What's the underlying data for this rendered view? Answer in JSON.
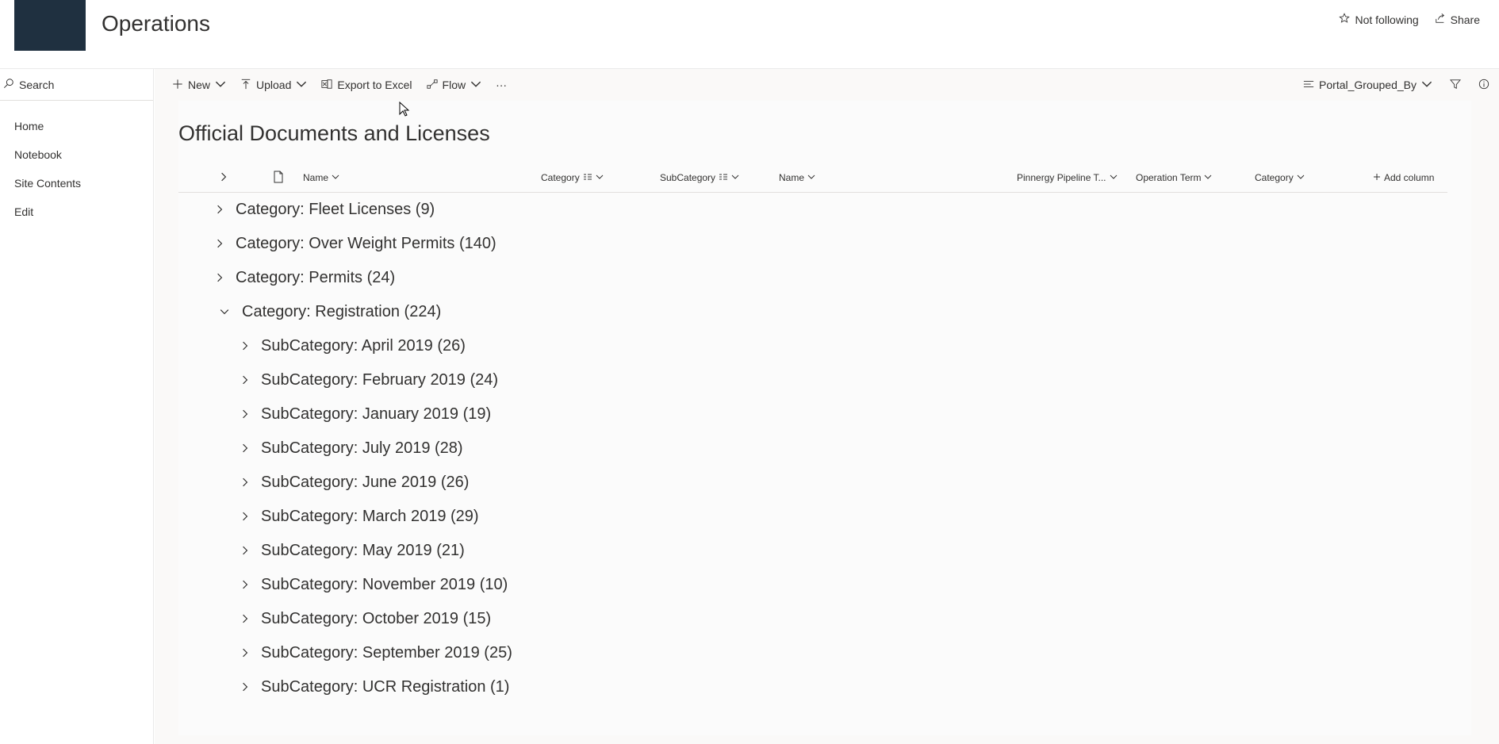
{
  "header": {
    "site_title": "Operations",
    "follow_label": "Not following",
    "share_label": "Share",
    "logo_color": "#1f3040"
  },
  "leftnav": {
    "search_placeholder": "Search",
    "items": [
      {
        "label": "Home"
      },
      {
        "label": "Notebook"
      },
      {
        "label": "Site Contents"
      },
      {
        "label": "Edit"
      }
    ]
  },
  "commandbar": {
    "new_label": "New",
    "upload_label": "Upload",
    "export_label": "Export to Excel",
    "flow_label": "Flow",
    "more_label": "···",
    "view_label": "Portal_Grouped_By"
  },
  "list": {
    "title": "Official Documents and Licenses",
    "columns": [
      {
        "label": "Name"
      },
      {
        "label": "Category"
      },
      {
        "label": "SubCategory"
      },
      {
        "label": "Name"
      },
      {
        "label": "Pinnergy Pipeline T..."
      },
      {
        "label": "Operation Term"
      },
      {
        "label": "Category"
      },
      {
        "label": "Add column"
      }
    ],
    "groups": [
      {
        "label": "Category: Fleet Licenses (9)",
        "expanded": false
      },
      {
        "label": "Category: Over Weight Permits (140)",
        "expanded": false
      },
      {
        "label": "Category: Permits (24)",
        "expanded": false
      },
      {
        "label": "Category: Registration (224)",
        "expanded": true,
        "subgroups": [
          {
            "label": "SubCategory: April 2019 (26)"
          },
          {
            "label": "SubCategory: February 2019 (24)"
          },
          {
            "label": "SubCategory: January 2019 (19)"
          },
          {
            "label": "SubCategory: July 2019 (28)"
          },
          {
            "label": "SubCategory: June 2019 (26)"
          },
          {
            "label": "SubCategory: March 2019 (29)"
          },
          {
            "label": "SubCategory: May 2019 (21)"
          },
          {
            "label": "SubCategory: November 2019 (10)"
          },
          {
            "label": "SubCategory: October 2019 (15)"
          },
          {
            "label": "SubCategory: September 2019 (25)"
          },
          {
            "label": "SubCategory: UCR Registration (1)"
          }
        ]
      }
    ]
  }
}
